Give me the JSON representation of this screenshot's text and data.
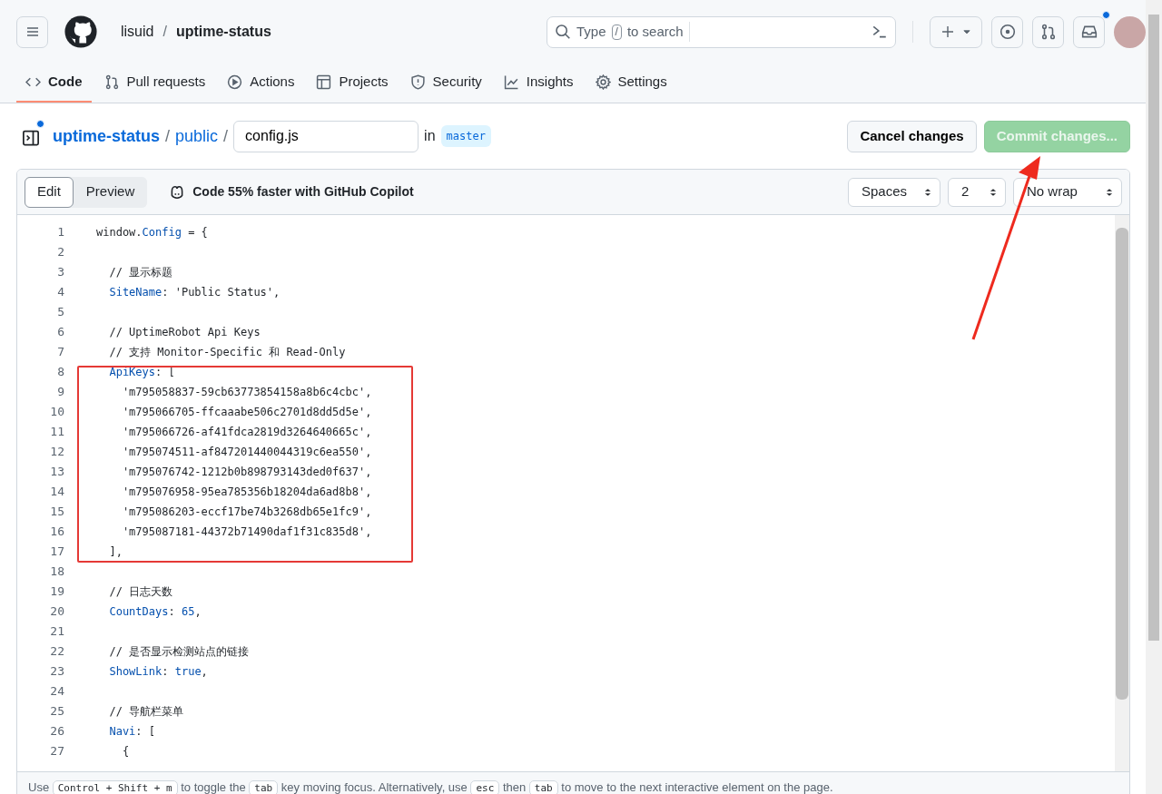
{
  "header": {
    "owner": "lisuid",
    "separator": "/",
    "repo": "uptime-status",
    "search": {
      "parts": [
        {
          "text": "Type",
          "kind": "text"
        },
        {
          "text": "/",
          "kind": "key"
        },
        {
          "text": "to search",
          "kind": "text"
        }
      ]
    },
    "inbox_unread": true
  },
  "repo_tabs": [
    {
      "label": "Code",
      "selected": true
    },
    {
      "label": "Pull requests",
      "selected": false
    },
    {
      "label": "Actions",
      "selected": false
    },
    {
      "label": "Projects",
      "selected": false
    },
    {
      "label": "Security",
      "selected": false
    },
    {
      "label": "Insights",
      "selected": false
    },
    {
      "label": "Settings",
      "selected": false
    }
  ],
  "breadcrumb": {
    "sidebar_unread": true,
    "repo": "uptime-status",
    "sep1": "/",
    "folder": "public",
    "sep2": "/",
    "filename": "config.js",
    "in": "in",
    "branch": "master"
  },
  "actions": [
    {
      "label": "Cancel changes",
      "kind": "secondary",
      "disabled": false
    },
    {
      "label": "Commit changes...",
      "kind": "primary",
      "disabled": true
    }
  ],
  "editor_modes": [
    {
      "label": "Edit",
      "selected": true
    },
    {
      "label": "Preview",
      "selected": false
    }
  ],
  "copilot": "Code 55% faster with GitHub Copilot",
  "selects": [
    {
      "value": "Spaces"
    },
    {
      "value": "2"
    },
    {
      "value": "No wrap"
    }
  ],
  "code_lines": [
    {
      "number": "1",
      "tokens": [
        {
          "text": "window.",
          "kind": "plain"
        },
        {
          "text": "Config",
          "kind": "key"
        },
        {
          "text": " = {",
          "kind": "plain"
        }
      ]
    },
    {
      "number": "2"
    },
    {
      "number": "3",
      "tokens": [
        {
          "text": "  // 显示标题",
          "kind": "plain"
        }
      ]
    },
    {
      "number": "4",
      "tokens": [
        {
          "text": "  SiteName",
          "kind": "key"
        },
        {
          "text": ": 'Public Status',",
          "kind": "plain"
        }
      ]
    },
    {
      "number": "5"
    },
    {
      "number": "6",
      "tokens": [
        {
          "text": "  // UptimeRobot Api Keys",
          "kind": "plain"
        }
      ]
    },
    {
      "number": "7",
      "tokens": [
        {
          "text": "  // 支持 Monitor-Specific 和 Read-Only",
          "kind": "plain"
        }
      ]
    },
    {
      "number": "8",
      "tokens": [
        {
          "text": "  ApiKeys",
          "kind": "key"
        },
        {
          "text": ": [",
          "kind": "plain"
        }
      ]
    },
    {
      "number": "9",
      "tokens": [
        {
          "text": "    'm795058837-59cb63773854158a8b6c4cbc',",
          "kind": "plain"
        }
      ]
    },
    {
      "number": "10",
      "tokens": [
        {
          "text": "    'm795066705-ffcaaabe506c2701d8dd5d5e',",
          "kind": "plain"
        }
      ]
    },
    {
      "number": "11",
      "tokens": [
        {
          "text": "    'm795066726-af41fdca2819d3264640665c',",
          "kind": "plain"
        }
      ]
    },
    {
      "number": "12",
      "tokens": [
        {
          "text": "    'm795074511-af847201440044319c6ea550',",
          "kind": "plain"
        }
      ]
    },
    {
      "number": "13",
      "tokens": [
        {
          "text": "    'm795076742-1212b0b898793143ded0f637',",
          "kind": "plain"
        }
      ]
    },
    {
      "number": "14",
      "tokens": [
        {
          "text": "    'm795076958-95ea785356b18204da6ad8b8',",
          "kind": "plain"
        }
      ]
    },
    {
      "number": "15",
      "tokens": [
        {
          "text": "    'm795086203-eccf17be74b3268db65e1fc9',",
          "kind": "plain"
        }
      ]
    },
    {
      "number": "16",
      "tokens": [
        {
          "text": "    'm795087181-44372b71490daf1f31c835d8',",
          "kind": "plain"
        }
      ]
    },
    {
      "number": "17",
      "tokens": [
        {
          "text": "  ],",
          "kind": "plain"
        }
      ]
    },
    {
      "number": "18"
    },
    {
      "number": "19",
      "tokens": [
        {
          "text": "  // 日志天数",
          "kind": "plain"
        }
      ]
    },
    {
      "number": "20",
      "tokens": [
        {
          "text": "  CountDays",
          "kind": "key"
        },
        {
          "text": ": ",
          "kind": "plain"
        },
        {
          "text": "65",
          "kind": "key"
        },
        {
          "text": ",",
          "kind": "plain"
        }
      ]
    },
    {
      "number": "21"
    },
    {
      "number": "22",
      "tokens": [
        {
          "text": "  // 是否显示检测站点的链接",
          "kind": "plain"
        }
      ]
    },
    {
      "number": "23",
      "tokens": [
        {
          "text": "  ShowLink",
          "kind": "key"
        },
        {
          "text": ": ",
          "kind": "plain"
        },
        {
          "text": "true",
          "kind": "key"
        },
        {
          "text": ",",
          "kind": "plain"
        }
      ]
    },
    {
      "number": "24"
    },
    {
      "number": "25",
      "tokens": [
        {
          "text": "  // 导航栏菜单",
          "kind": "plain"
        }
      ]
    },
    {
      "number": "26",
      "tokens": [
        {
          "text": "  Navi",
          "kind": "key"
        },
        {
          "text": ": [",
          "kind": "plain"
        }
      ]
    },
    {
      "number": "27",
      "tokens": [
        {
          "text": "    {",
          "kind": "plain"
        }
      ]
    }
  ],
  "help": [
    {
      "text": "Use ",
      "kind": "text"
    },
    {
      "text": "Control + Shift + m",
      "kind": "key"
    },
    {
      "text": " to toggle the ",
      "kind": "text"
    },
    {
      "text": "tab",
      "kind": "key"
    },
    {
      "text": " key moving focus. Alternatively, use ",
      "kind": "text"
    },
    {
      "text": "esc",
      "kind": "key"
    },
    {
      "text": " then ",
      "kind": "text"
    },
    {
      "text": "tab",
      "kind": "key"
    },
    {
      "text": " to move to the next interactive element on the page.",
      "kind": "text"
    }
  ]
}
